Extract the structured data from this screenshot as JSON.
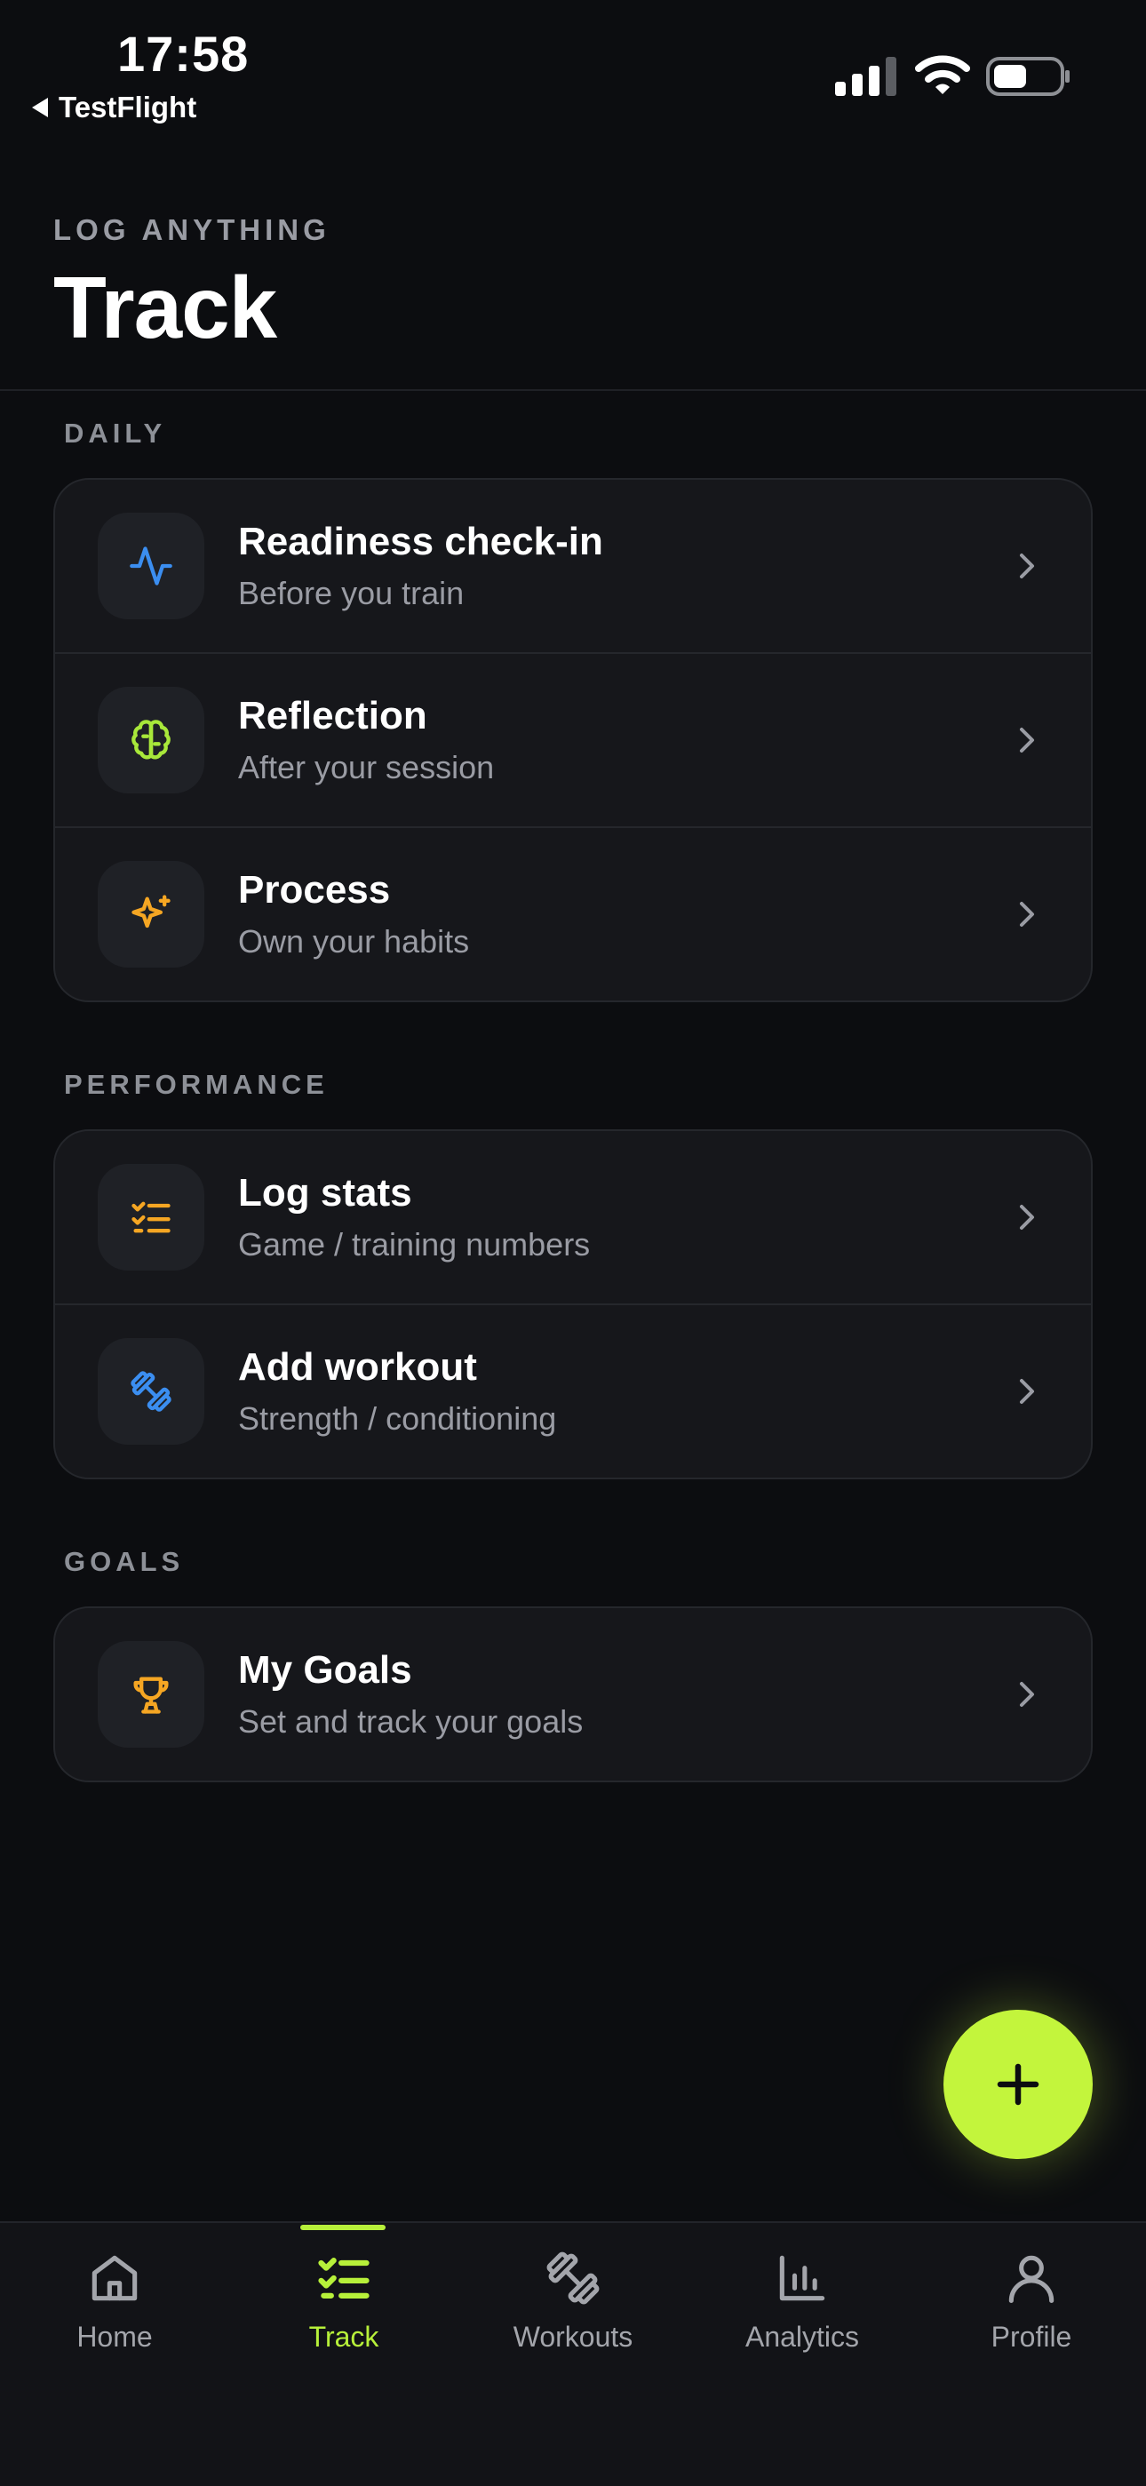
{
  "status_bar": {
    "time": "17:58",
    "back_label": "TestFlight"
  },
  "header": {
    "eyebrow": "LOG ANYTHING",
    "title": "Track"
  },
  "sections": {
    "daily": {
      "label": "DAILY",
      "items": [
        {
          "title": "Readiness check-in",
          "subtitle": "Before you train",
          "icon": "activity-icon",
          "color": "#3b8ef0"
        },
        {
          "title": "Reflection",
          "subtitle": "After your session",
          "icon": "brain-icon",
          "color": "#a8e83a"
        },
        {
          "title": "Process",
          "subtitle": "Own your habits",
          "icon": "sparkles-icon",
          "color": "#f5a623"
        }
      ]
    },
    "performance": {
      "label": "PERFORMANCE",
      "items": [
        {
          "title": "Log stats",
          "subtitle": "Game / training numbers",
          "icon": "list-checks-icon",
          "color": "#f5a623"
        },
        {
          "title": "Add workout",
          "subtitle": "Strength / conditioning",
          "icon": "dumbbell-icon",
          "color": "#3b8ef0"
        }
      ]
    },
    "goals": {
      "label": "GOALS",
      "items": [
        {
          "title": "My Goals",
          "subtitle": "Set and track your goals",
          "icon": "trophy-icon",
          "color": "#f5a623"
        }
      ]
    }
  },
  "fab": {
    "icon": "plus-icon",
    "color": "#c3f53c"
  },
  "tabbar": {
    "active": "Track",
    "accent": "#b7f03a",
    "tabs": [
      {
        "label": "Home",
        "icon": "home-icon"
      },
      {
        "label": "Track",
        "icon": "list-checks-icon"
      },
      {
        "label": "Workouts",
        "icon": "dumbbell-icon"
      },
      {
        "label": "Analytics",
        "icon": "bar-chart-icon"
      },
      {
        "label": "Profile",
        "icon": "user-icon"
      }
    ]
  }
}
